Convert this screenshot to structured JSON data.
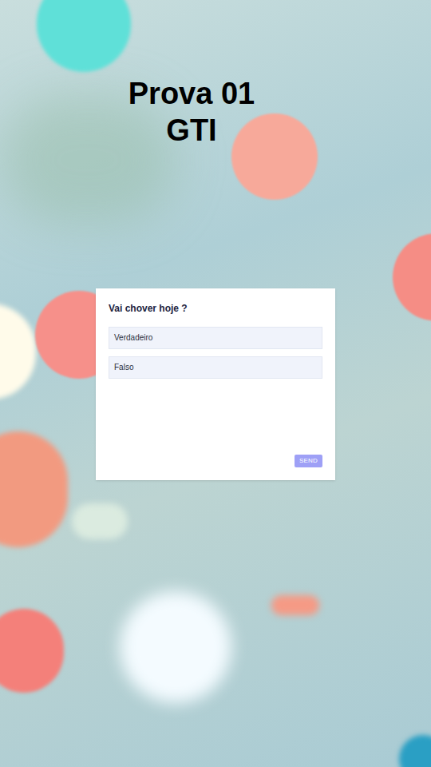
{
  "title": {
    "lines": [
      "Prova 01",
      "GTI"
    ]
  },
  "form": {
    "question": "Vai chover hoje ?",
    "options": [
      {
        "label": "Verdadeiro",
        "selected": false
      },
      {
        "label": "Falso",
        "selected": false
      }
    ],
    "button": {
      "label": "SEND",
      "disabled": true
    }
  }
}
